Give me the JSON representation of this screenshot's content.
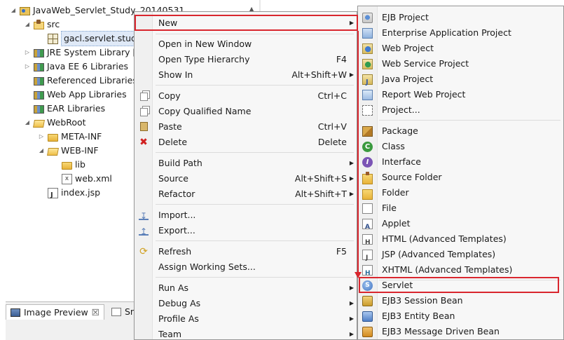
{
  "tree": {
    "project": "JavaWeb_Servlet_Study_20140531",
    "src": "src",
    "package": "gacl.servlet.study",
    "jre": "JRE System Library [S",
    "javaee": "Java EE 6 Libraries",
    "referenced": "Referenced Libraries",
    "webapp": "Web App Libraries",
    "ear": "EAR Libraries",
    "webroot": "WebRoot",
    "metainf": "META-INF",
    "webinf": "WEB-INF",
    "lib": "lib",
    "webxml": "web.xml",
    "indexjsp": "index.jsp"
  },
  "views": {
    "image_preview": "Image Preview",
    "close_glyph": "☒",
    "sn": "Sn"
  },
  "context_menu": {
    "new": "New",
    "open_new_window": "Open in New Window",
    "open_type_hierarchy": "Open Type Hierarchy",
    "open_type_hierarchy_key": "F4",
    "show_in": "Show In",
    "show_in_key": "Alt+Shift+W",
    "copy": "Copy",
    "copy_key": "Ctrl+C",
    "copy_qualified": "Copy Qualified Name",
    "paste": "Paste",
    "paste_key": "Ctrl+V",
    "delete": "Delete",
    "delete_key": "Delete",
    "build_path": "Build Path",
    "source": "Source",
    "source_key": "Alt+Shift+S",
    "refactor": "Refactor",
    "refactor_key": "Alt+Shift+T",
    "import": "Import...",
    "export": "Export...",
    "refresh": "Refresh",
    "refresh_key": "F5",
    "assign_working_sets": "Assign Working Sets...",
    "run_as": "Run As",
    "debug_as": "Debug As",
    "profile_as": "Profile As",
    "team": "Team"
  },
  "new_submenu": {
    "ejb_project": "EJB Project",
    "enterprise_app_project": "Enterprise Application Project",
    "web_project": "Web Project",
    "web_service_project": "Web Service Project",
    "java_project": "Java Project",
    "report_web_project": "Report Web Project",
    "project": "Project...",
    "package": "Package",
    "class": "Class",
    "interface": "Interface",
    "source_folder": "Source Folder",
    "folder": "Folder",
    "file": "File",
    "applet": "Applet",
    "html": "HTML (Advanced Templates)",
    "jsp": "JSP (Advanced Templates)",
    "xhtml": "XHTML (Advanced Templates)",
    "servlet": "Servlet",
    "ejb3_session": "EJB3 Session Bean",
    "ejb3_entity": "EJB3 Entity Bean",
    "ejb3_message": "EJB3 Message Driven Bean"
  },
  "colors": {
    "highlight_annotation": "#d9262e",
    "selection_bg": "#dfe9f7"
  }
}
